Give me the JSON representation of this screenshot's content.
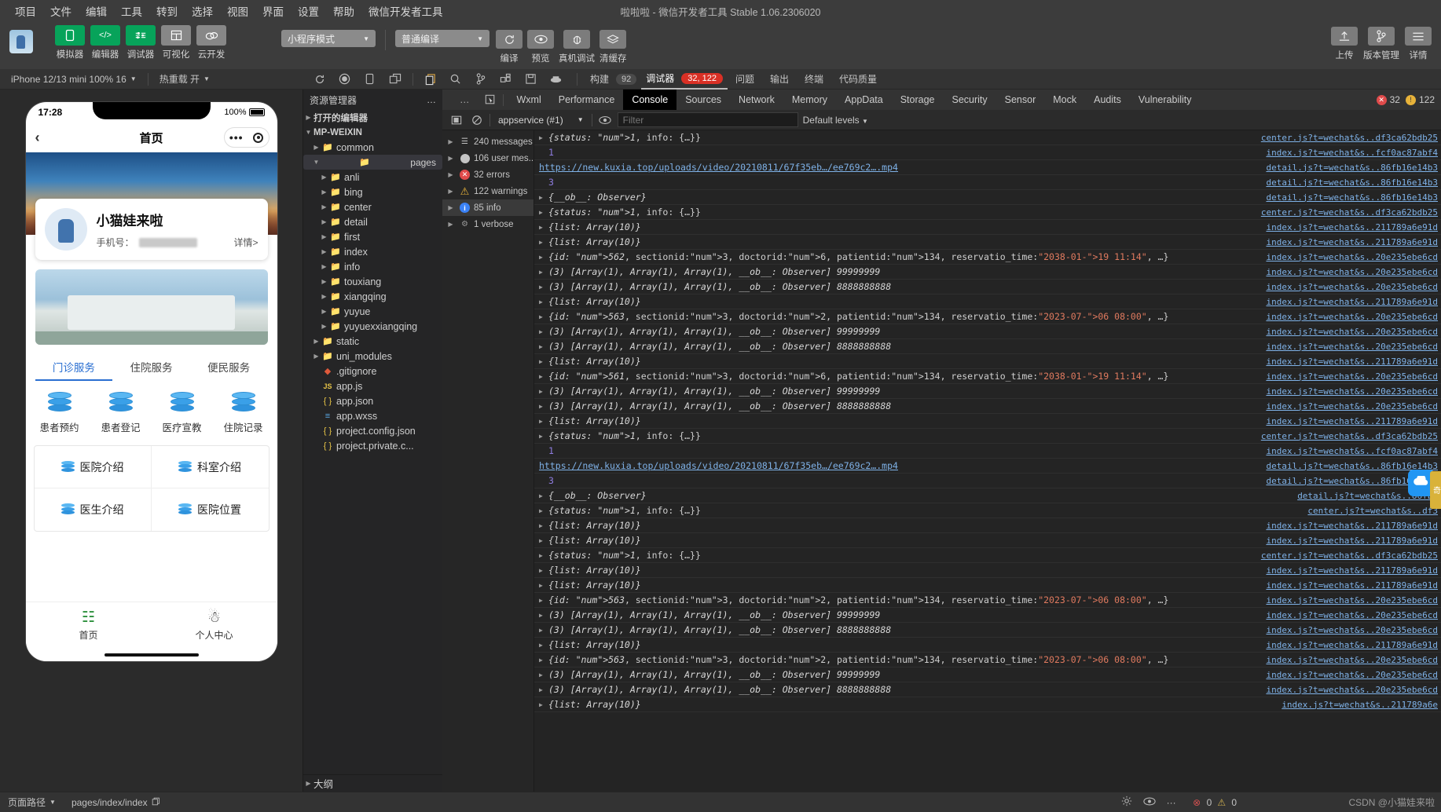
{
  "window": {
    "title": "啦啦啦 - 微信开发者工具 Stable 1.06.2306020"
  },
  "menubar": {
    "items": [
      "项目",
      "文件",
      "编辑",
      "工具",
      "转到",
      "选择",
      "视图",
      "界面",
      "设置",
      "帮助",
      "微信开发者工具"
    ]
  },
  "toolbar": {
    "modes": [
      {
        "label": "模拟器",
        "icon": "phone-icon",
        "style": "green"
      },
      {
        "label": "编辑器",
        "icon": "code-icon",
        "style": "green"
      },
      {
        "label": "调试器",
        "icon": "debug-icon",
        "style": "green"
      },
      {
        "label": "可视化",
        "icon": "layout-icon",
        "style": "grey"
      },
      {
        "label": "云开发",
        "icon": "cloud-icon",
        "style": "grey"
      }
    ],
    "mode_select": "小程序模式",
    "compile_select": "普通编译",
    "actions": [
      {
        "label": "编译",
        "icon": "refresh-icon"
      },
      {
        "label": "预览",
        "icon": "eye-icon"
      },
      {
        "label": "真机调试",
        "icon": "bug-icon"
      },
      {
        "label": "清缓存",
        "icon": "layers-icon"
      }
    ],
    "right": [
      {
        "label": "上传",
        "icon": "upload-icon"
      },
      {
        "label": "版本管理",
        "icon": "branch-icon"
      },
      {
        "label": "详情",
        "icon": "menu-icon"
      }
    ]
  },
  "devicebar": {
    "device": "iPhone 12/13 mini 100% 16",
    "hotreload": "热重载 开",
    "icons": [
      "refresh-icon",
      "record-icon",
      "phone-icon",
      "split-icon",
      "copy-icon",
      "search-icon",
      "branch-icon",
      "grid-icon",
      "save-icon",
      "docker-icon"
    ]
  },
  "statusTabs": {
    "build_label": "构建",
    "build_count": "92",
    "debugger_label": "调试器",
    "debugger_count": "32, 122",
    "others": [
      "问题",
      "输出",
      "终端",
      "代码质量"
    ]
  },
  "explorer": {
    "title": "资源管理器",
    "more": "…",
    "open_editors": "打开的编辑器",
    "root": "MP-WEIXIN",
    "tree": [
      {
        "label": "common",
        "type": "folder",
        "depth": 1,
        "open": false
      },
      {
        "label": "pages",
        "type": "folder-open",
        "depth": 1,
        "open": true,
        "selected": true
      },
      {
        "label": "anli",
        "type": "folder",
        "depth": 2
      },
      {
        "label": "bing",
        "type": "folder",
        "depth": 2
      },
      {
        "label": "center",
        "type": "folder",
        "depth": 2
      },
      {
        "label": "detail",
        "type": "folder",
        "depth": 2
      },
      {
        "label": "first",
        "type": "folder",
        "depth": 2
      },
      {
        "label": "index",
        "type": "folder",
        "depth": 2
      },
      {
        "label": "info",
        "type": "folder",
        "depth": 2
      },
      {
        "label": "touxiang",
        "type": "folder",
        "depth": 2
      },
      {
        "label": "xiangqing",
        "type": "folder",
        "depth": 2
      },
      {
        "label": "yuyue",
        "type": "folder",
        "depth": 2
      },
      {
        "label": "yuyuexxiangqing",
        "type": "folder",
        "depth": 2
      },
      {
        "label": "static",
        "type": "folder-static",
        "depth": 1
      },
      {
        "label": "uni_modules",
        "type": "folder",
        "depth": 1
      },
      {
        "label": ".gitignore",
        "type": "git",
        "depth": 1
      },
      {
        "label": "app.js",
        "type": "js",
        "depth": 1
      },
      {
        "label": "app.json",
        "type": "json",
        "depth": 1
      },
      {
        "label": "app.wxss",
        "type": "wxss",
        "depth": 1
      },
      {
        "label": "project.config.json",
        "type": "json",
        "depth": 1
      },
      {
        "label": "project.private.c...",
        "type": "json",
        "depth": 1
      }
    ],
    "outline": "大纲"
  },
  "devtools": {
    "dots": "…",
    "inspect_icon": "cursor-select-icon",
    "tabs": [
      "Wxml",
      "Performance",
      "Console",
      "Sources",
      "Network",
      "Memory",
      "AppData",
      "Storage",
      "Security",
      "Sensor",
      "Mock",
      "Audits",
      "Vulnerability"
    ],
    "active_tab": "Console",
    "error_count": "32",
    "warning_count": "122",
    "filterbar": {
      "sidebar_icon": "panel-toggle-icon",
      "clear_icon": "clear-console-icon",
      "context": "appservice (#1)",
      "eye_icon": "eye-icon",
      "filter_placeholder": "Filter",
      "levels": "Default levels"
    },
    "message_counts": [
      {
        "label": "240 messages",
        "icon": "list-icon",
        "color": "#cfcfcf"
      },
      {
        "label": "106 user mes...",
        "icon": "user-icon",
        "color": "#cfcfcf"
      },
      {
        "label": "32 errors",
        "icon": "error-icon",
        "color": "#e04b4b"
      },
      {
        "label": "122 warnings",
        "icon": "warning-icon",
        "color": "#e8b33a"
      },
      {
        "label": "85 info",
        "icon": "info-icon",
        "color": "#3b82f6",
        "selected": true
      },
      {
        "label": "1 verbose",
        "icon": "verbose-icon",
        "color": "#9a9a9a"
      }
    ],
    "logs": [
      {
        "kind": "obj",
        "text": "{status: 1, info: {…}}",
        "src": "center.js?t=wechat&s..df3ca62bdb25"
      },
      {
        "kind": "num",
        "text": "1",
        "src": "index.js?t=wechat&s..fcf0ac87abf4"
      },
      {
        "kind": "url",
        "text": "https://new.kuxia.top/uploads/video/20210811/67f35eb…/ee769c2….mp4",
        "src": "detail.js?t=wechat&s..86fb16e14b3"
      },
      {
        "kind": "num",
        "text": "3",
        "src": "detail.js?t=wechat&s..86fb16e14b3"
      },
      {
        "kind": "obj",
        "text": "{__ob__: Observer}",
        "src": "detail.js?t=wechat&s..86fb16e14b3"
      },
      {
        "kind": "obj",
        "text": "{status: 1, info: {…}}",
        "src": "center.js?t=wechat&s..df3ca62bdb25"
      },
      {
        "kind": "obj",
        "text": "{list: Array(10)}",
        "src": "index.js?t=wechat&s..211789a6e91d"
      },
      {
        "kind": "obj",
        "text": "{list: Array(10)}",
        "src": "index.js?t=wechat&s..211789a6e91d"
      },
      {
        "kind": "rec",
        "text": "{id: 562, sectionid: 3, doctorid: 6, patientid: 134, reservatio_time: \"2038-01-19 11:14\", …}",
        "src": "index.js?t=wechat&s..20e235ebe6cd"
      },
      {
        "kind": "arr",
        "text": "(3) [Array(1), Array(1), Array(1), __ob__: Observer] 99999999",
        "src": "index.js?t=wechat&s..20e235ebe6cd"
      },
      {
        "kind": "arr",
        "text": "(3) [Array(1), Array(1), Array(1), __ob__: Observer] 8888888888",
        "src": "index.js?t=wechat&s..20e235ebe6cd"
      },
      {
        "kind": "obj",
        "text": "{list: Array(10)}",
        "src": "index.js?t=wechat&s..211789a6e91d"
      },
      {
        "kind": "rec",
        "text": "{id: 563, sectionid: 3, doctorid: 2, patientid: 134, reservatio_time: \"2023-07-06 08:00\", …}",
        "src": "index.js?t=wechat&s..20e235ebe6cd"
      },
      {
        "kind": "arr",
        "text": "(3) [Array(1), Array(1), Array(1), __ob__: Observer] 99999999",
        "src": "index.js?t=wechat&s..20e235ebe6cd"
      },
      {
        "kind": "arr",
        "text": "(3) [Array(1), Array(1), Array(1), __ob__: Observer] 8888888888",
        "src": "index.js?t=wechat&s..20e235ebe6cd"
      },
      {
        "kind": "obj",
        "text": "{list: Array(10)}",
        "src": "index.js?t=wechat&s..211789a6e91d"
      },
      {
        "kind": "rec",
        "text": "{id: 561, sectionid: 3, doctorid: 6, patientid: 134, reservatio_time: \"2038-01-19 11:14\", …}",
        "src": "index.js?t=wechat&s..20e235ebe6cd"
      },
      {
        "kind": "arr",
        "text": "(3) [Array(1), Array(1), Array(1), __ob__: Observer] 99999999",
        "src": "index.js?t=wechat&s..20e235ebe6cd"
      },
      {
        "kind": "arr",
        "text": "(3) [Array(1), Array(1), Array(1), __ob__: Observer] 8888888888",
        "src": "index.js?t=wechat&s..20e235ebe6cd"
      },
      {
        "kind": "obj",
        "text": "{list: Array(10)}",
        "src": "index.js?t=wechat&s..211789a6e91d"
      },
      {
        "kind": "obj",
        "text": "{status: 1, info: {…}}",
        "src": "center.js?t=wechat&s..df3ca62bdb25"
      },
      {
        "kind": "num",
        "text": "1",
        "src": "index.js?t=wechat&s..fcf0ac87abf4"
      },
      {
        "kind": "url",
        "text": "https://new.kuxia.top/uploads/video/20210811/67f35eb…/ee769c2….mp4",
        "src": "detail.js?t=wechat&s..86fb16e14b3"
      },
      {
        "kind": "num",
        "text": "3",
        "src": "detail.js?t=wechat&s..86fb16e14b3"
      },
      {
        "kind": "obj",
        "text": "{__ob__: Observer}",
        "src": "detail.js?t=wechat&s..86fb1"
      },
      {
        "kind": "obj",
        "text": "{status: 1, info: {…}}",
        "src": "center.js?t=wechat&s..df3"
      },
      {
        "kind": "obj",
        "text": "{list: Array(10)}",
        "src": "index.js?t=wechat&s..211789a6e91d"
      },
      {
        "kind": "obj",
        "text": "{list: Array(10)}",
        "src": "index.js?t=wechat&s..211789a6e91d"
      },
      {
        "kind": "obj",
        "text": "{status: 1, info: {…}}",
        "src": "center.js?t=wechat&s..df3ca62bdb25"
      },
      {
        "kind": "obj",
        "text": "{list: Array(10)}",
        "src": "index.js?t=wechat&s..211789a6e91d"
      },
      {
        "kind": "obj",
        "text": "{list: Array(10)}",
        "src": "index.js?t=wechat&s..211789a6e91d"
      },
      {
        "kind": "rec",
        "text": "{id: 563, sectionid: 3, doctorid: 2, patientid: 134, reservatio_time: \"2023-07-06 08:00\", …}",
        "src": "index.js?t=wechat&s..20e235ebe6cd"
      },
      {
        "kind": "arr",
        "text": "(3) [Array(1), Array(1), Array(1), __ob__: Observer] 99999999",
        "src": "index.js?t=wechat&s..20e235ebe6cd"
      },
      {
        "kind": "arr",
        "text": "(3) [Array(1), Array(1), Array(1), __ob__: Observer] 8888888888",
        "src": "index.js?t=wechat&s..20e235ebe6cd"
      },
      {
        "kind": "obj",
        "text": "{list: Array(10)}",
        "src": "index.js?t=wechat&s..211789a6e91d"
      },
      {
        "kind": "rec",
        "text": "{id: 563, sectionid: 3, doctorid: 2, patientid: 134, reservatio_time: \"2023-07-06 08:00\", …}",
        "src": "index.js?t=wechat&s..20e235ebe6cd"
      },
      {
        "kind": "arr",
        "text": "(3) [Array(1), Array(1), Array(1), __ob__: Observer] 99999999",
        "src": "index.js?t=wechat&s..20e235ebe6cd"
      },
      {
        "kind": "arr",
        "text": "(3) [Array(1), Array(1), Array(1), __ob__: Observer] 8888888888",
        "src": "index.js?t=wechat&s..20e235ebe6cd"
      },
      {
        "kind": "obj",
        "text": "{list: Array(10)}",
        "src": "index.js?t=wechat&s..211789a6e"
      }
    ]
  },
  "simulator": {
    "status_time": "17:28",
    "battery": "100%",
    "nav_title": "首页",
    "user_name": "小猫娃来啦",
    "phone_label": "手机号：",
    "detail_link": "详情>",
    "tabs": [
      "门诊服务",
      "住院服务",
      "便民服务"
    ],
    "active_tab": "门诊服务",
    "grid": [
      "患者预约",
      "患者登记",
      "医疗宣教",
      "住院记录"
    ],
    "cards": [
      "医院介绍",
      "科室介绍",
      "医生介绍",
      "医院位置"
    ],
    "tabbar": [
      "首页",
      "个人中心"
    ]
  },
  "footer": {
    "page_path_label": "页面路径",
    "page_path": "pages/index/index",
    "copy_icon": "copy-icon",
    "err_count": "0",
    "warn_count": "0"
  },
  "watermark": "CSDN @小猫娃来啦"
}
